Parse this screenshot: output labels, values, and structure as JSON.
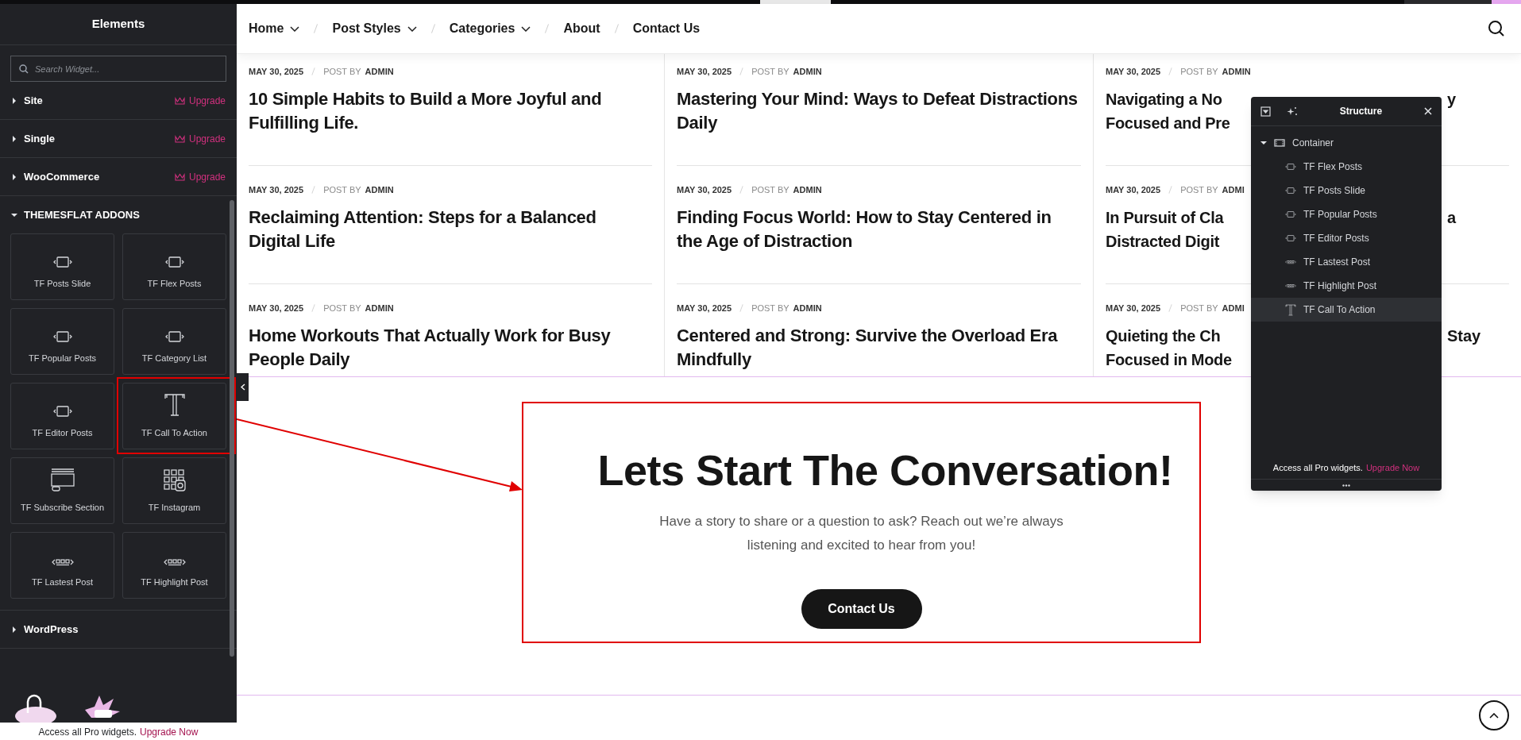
{
  "elements_panel": {
    "title": "Elements",
    "search": {
      "placeholder": "Search Widget..."
    },
    "categories": [
      {
        "label": "Site",
        "expanded": false,
        "badge": "Upgrade"
      },
      {
        "label": "Single",
        "expanded": false,
        "badge": "Upgrade"
      },
      {
        "label": "WooCommerce",
        "expanded": false,
        "badge": "Upgrade"
      },
      {
        "label": "THEMESFLAT ADDONS",
        "expanded": true,
        "widgets": [
          {
            "label": "TF Posts Slide",
            "kind": "posts",
            "highlighted": false
          },
          {
            "label": "TF Flex Posts",
            "kind": "posts",
            "highlighted": false
          },
          {
            "label": "TF Popular Posts",
            "kind": "posts",
            "highlighted": false
          },
          {
            "label": "TF Category List",
            "kind": "posts",
            "highlighted": false
          },
          {
            "label": "TF Editor Posts",
            "kind": "posts",
            "highlighted": false
          },
          {
            "label": "TF Call To Action",
            "kind": "text",
            "highlighted": true
          },
          {
            "label": "TF Subscribe Section",
            "kind": "subscribe",
            "highlighted": false
          },
          {
            "label": "TF Instagram",
            "kind": "instagram",
            "highlighted": false
          },
          {
            "label": "TF Lastest Post",
            "kind": "list",
            "highlighted": false
          },
          {
            "label": "TF Highlight Post",
            "kind": "list",
            "highlighted": false
          }
        ]
      },
      {
        "label": "WordPress",
        "expanded": false
      }
    ],
    "promo": {
      "text": "Access all Pro widgets.",
      "link": "Upgrade Now"
    }
  },
  "nav": {
    "items": [
      {
        "label": "Home",
        "dropdown": true
      },
      {
        "label": "Post Styles",
        "dropdown": true
      },
      {
        "label": "Categories",
        "dropdown": true
      },
      {
        "label": "About",
        "dropdown": false
      },
      {
        "label": "Contact Us",
        "dropdown": false
      }
    ]
  },
  "posts": {
    "columns": [
      [
        {
          "date": "MAY 30, 2025",
          "by": "POST BY",
          "author": "ADMIN",
          "kind": "full",
          "title": "10 Simple Habits to Build a More Joyful and Fulfilling Life."
        },
        {
          "date": "MAY 30, 2025",
          "by": "POST BY",
          "author": "ADMIN",
          "kind": "full",
          "title": "Reclaiming Attention: Steps for a Balanced Digital Life"
        },
        {
          "date": "MAY 30, 2025",
          "by": "POST BY",
          "author": "ADMIN",
          "kind": "full",
          "title": "Home Workouts That Actually Work for Busy People Daily"
        }
      ],
      [
        {
          "date": "MAY 30, 2025",
          "by": "POST BY",
          "author": "ADMIN",
          "kind": "full",
          "title": "Mastering Your Mind: Ways to Defeat Distractions Daily"
        },
        {
          "date": "MAY 30, 2025",
          "by": "POST BY",
          "author": "ADMIN",
          "kind": "full",
          "title": "Finding Focus World: How to Stay Centered in the Age of Distraction"
        },
        {
          "date": "MAY 30, 2025",
          "by": "POST BY",
          "author": "ADMIN",
          "kind": "full",
          "title": "Centered and Strong: Survive the Overload Era Mindfully"
        }
      ],
      [
        {
          "date": "MAY 30, 2025",
          "by": "POST BY",
          "author": "ADMIN",
          "kind": "covered",
          "lines": [
            {
              "text": "Navigating a No",
              "tail": "y"
            },
            {
              "text": "Focused and Pre"
            }
          ]
        },
        {
          "date": "MAY 30, 2025",
          "by": "POST BY",
          "author": "ADMI",
          "kind": "covered",
          "lines": [
            {
              "text": "In Pursuit of Cla",
              "tail": "a"
            },
            {
              "text": "Distracted Digit"
            }
          ]
        },
        {
          "date": "MAY 30, 2025",
          "by": "POST BY",
          "author": "ADMI",
          "kind": "covered",
          "lines": [
            {
              "text": "Quieting the Ch",
              "tail": "Stay"
            },
            {
              "text": "Focused in Mode"
            }
          ]
        }
      ]
    ]
  },
  "cta": {
    "highlighted": true,
    "heading": "Lets Start The Conversation!",
    "text": "Have a story to share or a question to ask? Reach out we’re always listening and excited to hear from you!",
    "button": "Contact Us"
  },
  "structure_panel": {
    "title": "Structure",
    "tree": [
      {
        "label": "Container",
        "kind": "container",
        "expanded": true,
        "selected": false,
        "children": [
          {
            "label": "TF Flex Posts",
            "kind": "posts",
            "selected": false
          },
          {
            "label": "TF Posts Slide",
            "kind": "posts",
            "selected": false
          },
          {
            "label": "TF Popular Posts",
            "kind": "posts",
            "selected": false
          },
          {
            "label": "TF Editor Posts",
            "kind": "posts",
            "selected": false
          },
          {
            "label": "TF Lastest Post",
            "kind": "list",
            "selected": false
          },
          {
            "label": "TF Highlight Post",
            "kind": "list",
            "selected": false
          },
          {
            "label": "TF Call To Action",
            "kind": "text",
            "selected": true
          }
        ]
      }
    ],
    "promo": {
      "text": "Access all Pro widgets.",
      "link": "Upgrade Now"
    }
  }
}
